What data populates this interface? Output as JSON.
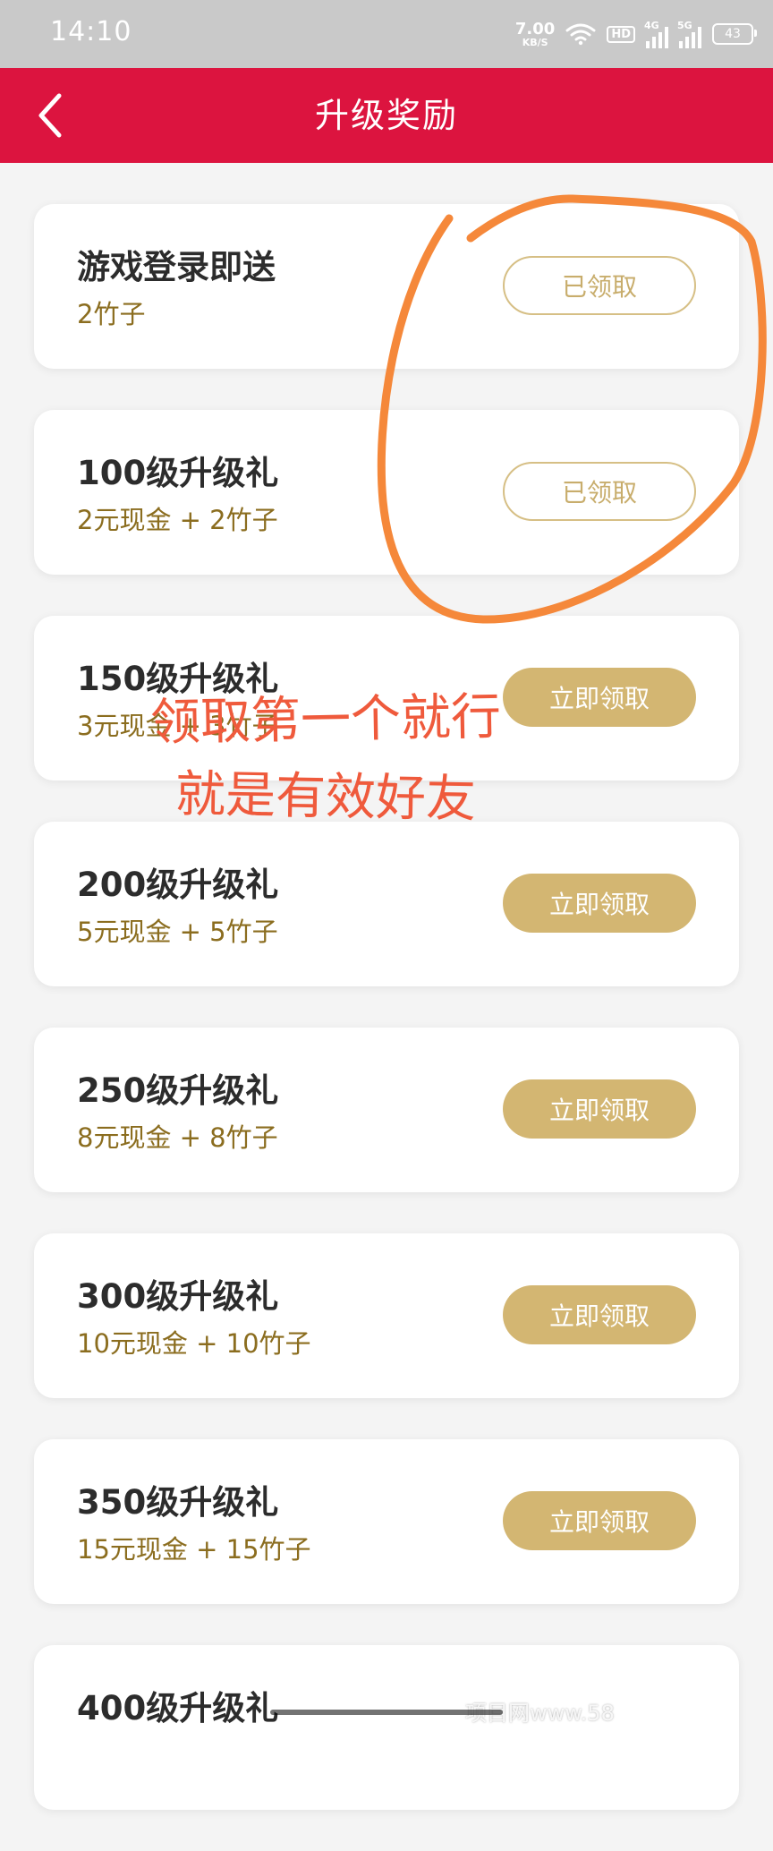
{
  "status_bar": {
    "time": "14:10",
    "net_speed_value": "7.00",
    "net_speed_unit": "KB/S",
    "hd_badge": "HD",
    "signal1_label": "4G",
    "signal2_label": "5G",
    "battery": "43"
  },
  "header": {
    "title": "升级奖励"
  },
  "rewards": [
    {
      "title": "游戏登录即送",
      "desc": "2竹子",
      "button": "已领取",
      "state": "claimed"
    },
    {
      "title": "100级升级礼",
      "desc": "2元现金 + 2竹子",
      "button": "已领取",
      "state": "claimed"
    },
    {
      "title": "150级升级礼",
      "desc": "3元现金 + 3竹子",
      "button": "立即领取",
      "state": "available"
    },
    {
      "title": "200级升级礼",
      "desc": "5元现金 + 5竹子",
      "button": "立即领取",
      "state": "available"
    },
    {
      "title": "250级升级礼",
      "desc": "8元现金 + 8竹子",
      "button": "立即领取",
      "state": "available"
    },
    {
      "title": "300级升级礼",
      "desc": "10元现金 + 10竹子",
      "button": "立即领取",
      "state": "available"
    },
    {
      "title": "350级升级礼",
      "desc": "15元现金 + 15竹子",
      "button": "立即领取",
      "state": "available"
    },
    {
      "title": "400级升级礼",
      "desc": "",
      "button": "",
      "state": "available"
    }
  ],
  "annotation": {
    "line1": "领取第一个就行",
    "line2": "就是有效好友",
    "color": "#ef5a3c",
    "circle_color": "#f5883a"
  },
  "watermark": "项目网www.58",
  "colors": {
    "header_bg": "#dc143f",
    "gold": "#d3b672",
    "desc_text": "#8b6d1f"
  }
}
